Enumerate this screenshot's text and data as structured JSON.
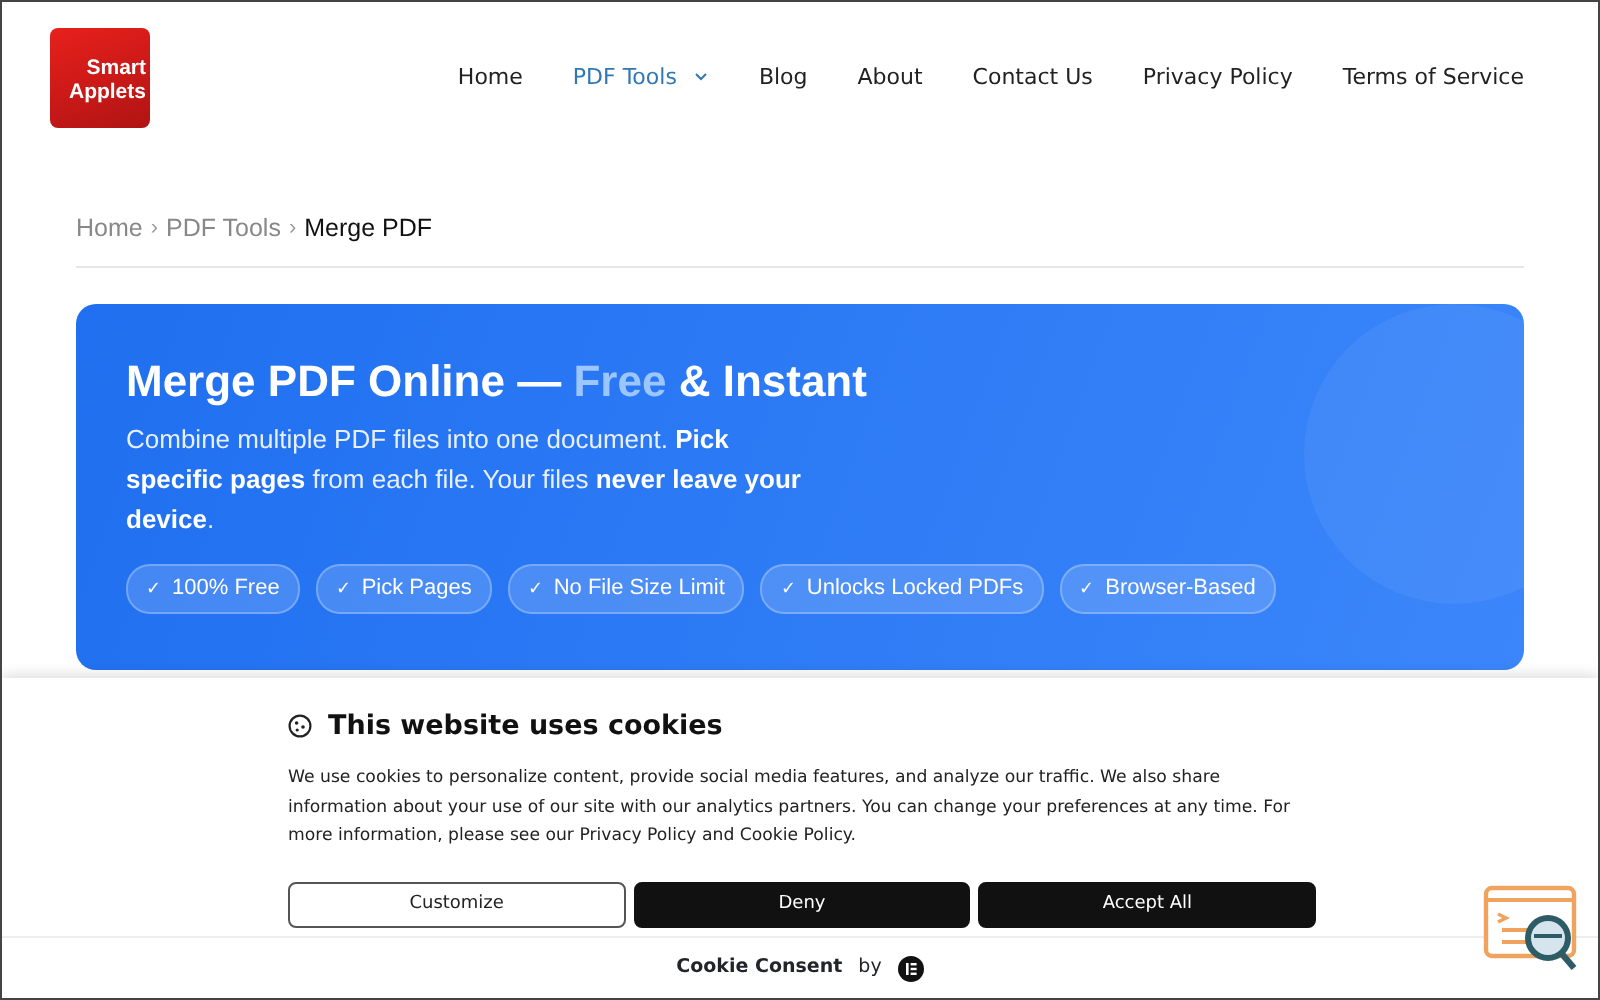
{
  "logo": {
    "line1": "Smart",
    "line2": "Applets"
  },
  "nav": [
    {
      "label": "Home",
      "selected": false,
      "dropdown": false
    },
    {
      "label": "PDF Tools",
      "selected": true,
      "dropdown": true
    },
    {
      "label": "Blog",
      "selected": false,
      "dropdown": false
    },
    {
      "label": "About",
      "selected": false,
      "dropdown": false
    },
    {
      "label": "Contact Us",
      "selected": false,
      "dropdown": false
    },
    {
      "label": "Privacy Policy",
      "selected": false,
      "dropdown": false
    },
    {
      "label": "Terms of Service",
      "selected": false,
      "dropdown": false
    }
  ],
  "breadcrumb": [
    {
      "label": "Home",
      "selected": false
    },
    {
      "label": "PDF Tools",
      "selected": false
    },
    {
      "label": "Merge PDF",
      "selected": true
    }
  ],
  "breadcrumb_separator": "›",
  "hero": {
    "title_parts": [
      {
        "text": "Merge PDF Online —",
        "highlight": false
      },
      {
        "text": "Free",
        "highlight": true
      },
      {
        "text": "& Instant",
        "highlight": false
      }
    ],
    "description": "Combine multiple PDF files into one document. **Pick specific pages** from each file. Your files **never leave your device**.",
    "features": [
      {
        "check": "✓",
        "label": "100% Free"
      },
      {
        "check": "✓",
        "label": "Pick Pages"
      },
      {
        "check": "✓",
        "label": "No File Size Limit"
      },
      {
        "check": "✓",
        "label": "Unlocks Locked PDFs"
      },
      {
        "check": "✓",
        "label": "Browser-Based"
      }
    ]
  },
  "cookie_banner": {
    "title": "This website uses cookies",
    "text": "We use cookies to personalize content, provide social media features, and analyze our traffic. We also share information about your use of our site with our analytics partners. You can change your preferences at any time. For more information, please see our Privacy Policy and Cookie Policy.",
    "buttons": [
      {
        "label": "Customize",
        "kind": "outline"
      },
      {
        "label": "Deny",
        "kind": "dark"
      },
      {
        "label": "Accept All",
        "kind": "dark"
      }
    ],
    "footer": {
      "label": "Cookie Consent",
      "by": "by"
    }
  }
}
